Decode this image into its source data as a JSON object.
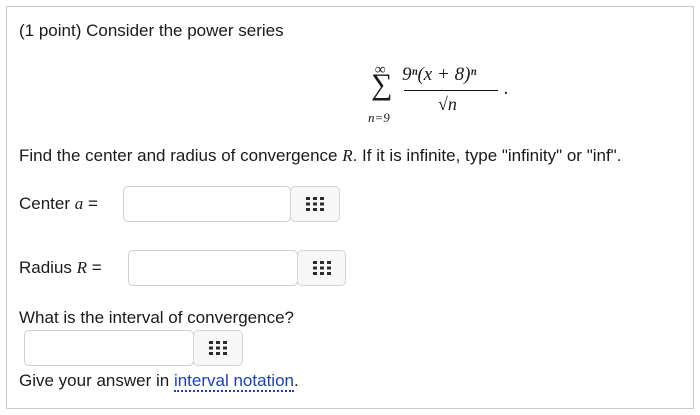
{
  "question": {
    "points": "(1 point)",
    "prompt": "Consider the power series",
    "series": {
      "upper_limit": "∞",
      "sigma": "∑",
      "lower_limit": "n=9",
      "numerator": "9ⁿ(x + 8)ⁿ",
      "denominator": "√n",
      "trailing": "."
    },
    "instruction_main": "Find the center and radius of convergence ",
    "instruction_var": "R",
    "instruction_tail": ". If it is infinite, type \"infinity\" or \"inf\"."
  },
  "center": {
    "label": "Center ",
    "var": "a",
    "eq": " =",
    "value": ""
  },
  "radius": {
    "label": "Radius ",
    "var": "R",
    "eq": " =",
    "value": ""
  },
  "interval": {
    "question": "What is the interval of convergence?",
    "value": "",
    "answer_prefix": "Give your answer in ",
    "link_text": "interval notation",
    "answer_suffix": "."
  },
  "icons": {
    "matrix": "matrix-grid-icon"
  }
}
